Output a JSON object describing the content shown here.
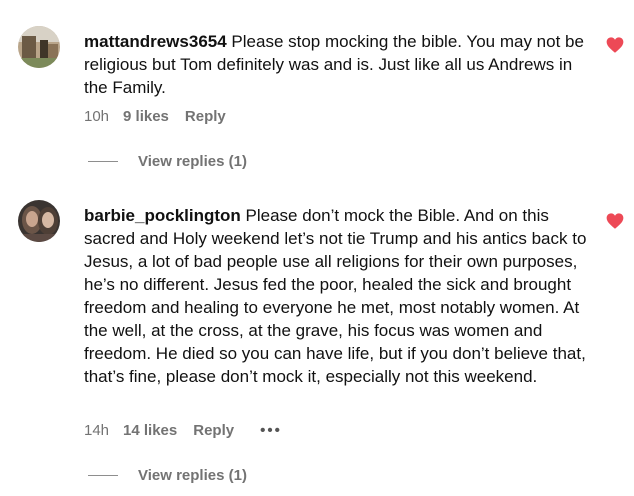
{
  "comments": [
    {
      "username": "mattandrews3654",
      "text": "Please stop mocking the bible. You may not be religious but Tom definitely was and is. Just like all us Andrews in the Family.",
      "time": "10h",
      "likes": "9 likes",
      "reply_label": "Reply",
      "view_replies": "View replies (1)",
      "liked": true
    },
    {
      "username": "barbie_pocklington",
      "text": "Please don’t mock the Bible. And on this sacred and Holy weekend let’s not tie Trump and his antics back to Jesus, a lot of bad people use all religions for their own purposes, he’s no different. Jesus fed the poor, healed the sick and brought freedom and healing to everyone he met, most notably women. At the well, at the cross, at the grave, his focus was women and freedom. He died so you can have life, but if you don’t believe that, that’s fine, please don’t mock it, especially not this weekend.",
      "time": "14h",
      "likes": "14 likes",
      "reply_label": "Reply",
      "more_label": "•••",
      "view_replies": "View replies (1)",
      "liked": true
    }
  ],
  "colors": {
    "heart": "#ed4956",
    "meta": "#737373",
    "text": "#111111"
  },
  "icons": {
    "like": "heart-icon",
    "more": "more-options-icon"
  }
}
